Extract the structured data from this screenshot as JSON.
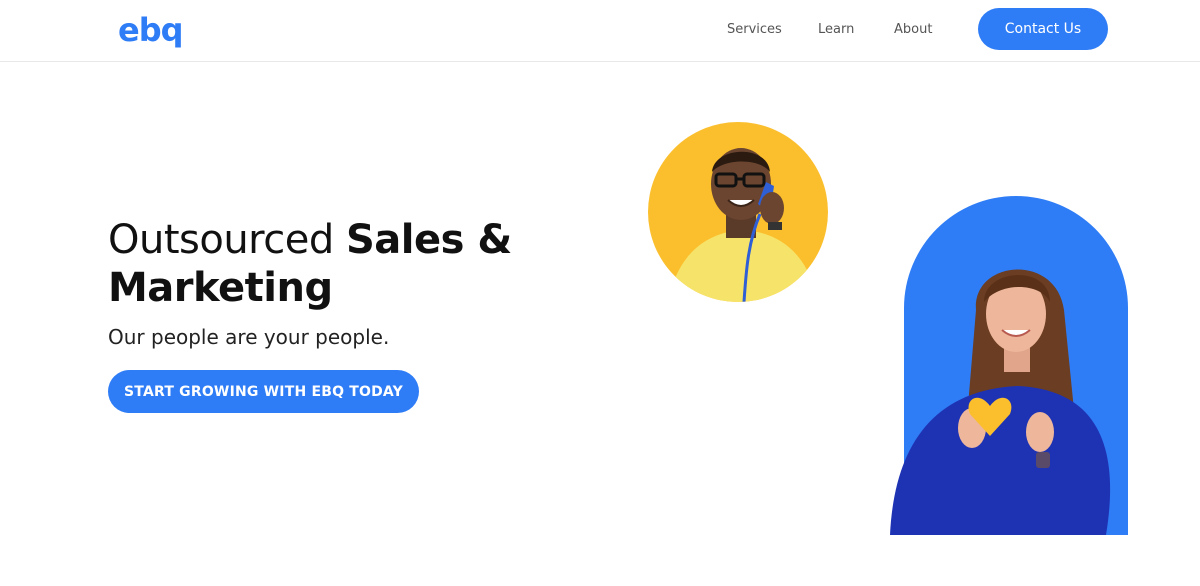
{
  "brand": {
    "logo_text": "ebq",
    "accent_color": "#2f7df6",
    "yellow": "#fbbf2d"
  },
  "nav": {
    "services": "Services",
    "learn": "Learn",
    "about": "About",
    "contact": "Contact Us"
  },
  "hero": {
    "title_light": "Outsourced ",
    "title_bold_1": "Sales &",
    "title_bold_2": "Marketing",
    "subtitle": "Our people are your people.",
    "cta": "START GROWING WITH EBQ TODAY"
  },
  "images": {
    "photo_1": "man-on-phone-photo",
    "photo_2": "woman-holding-heart-photo"
  }
}
